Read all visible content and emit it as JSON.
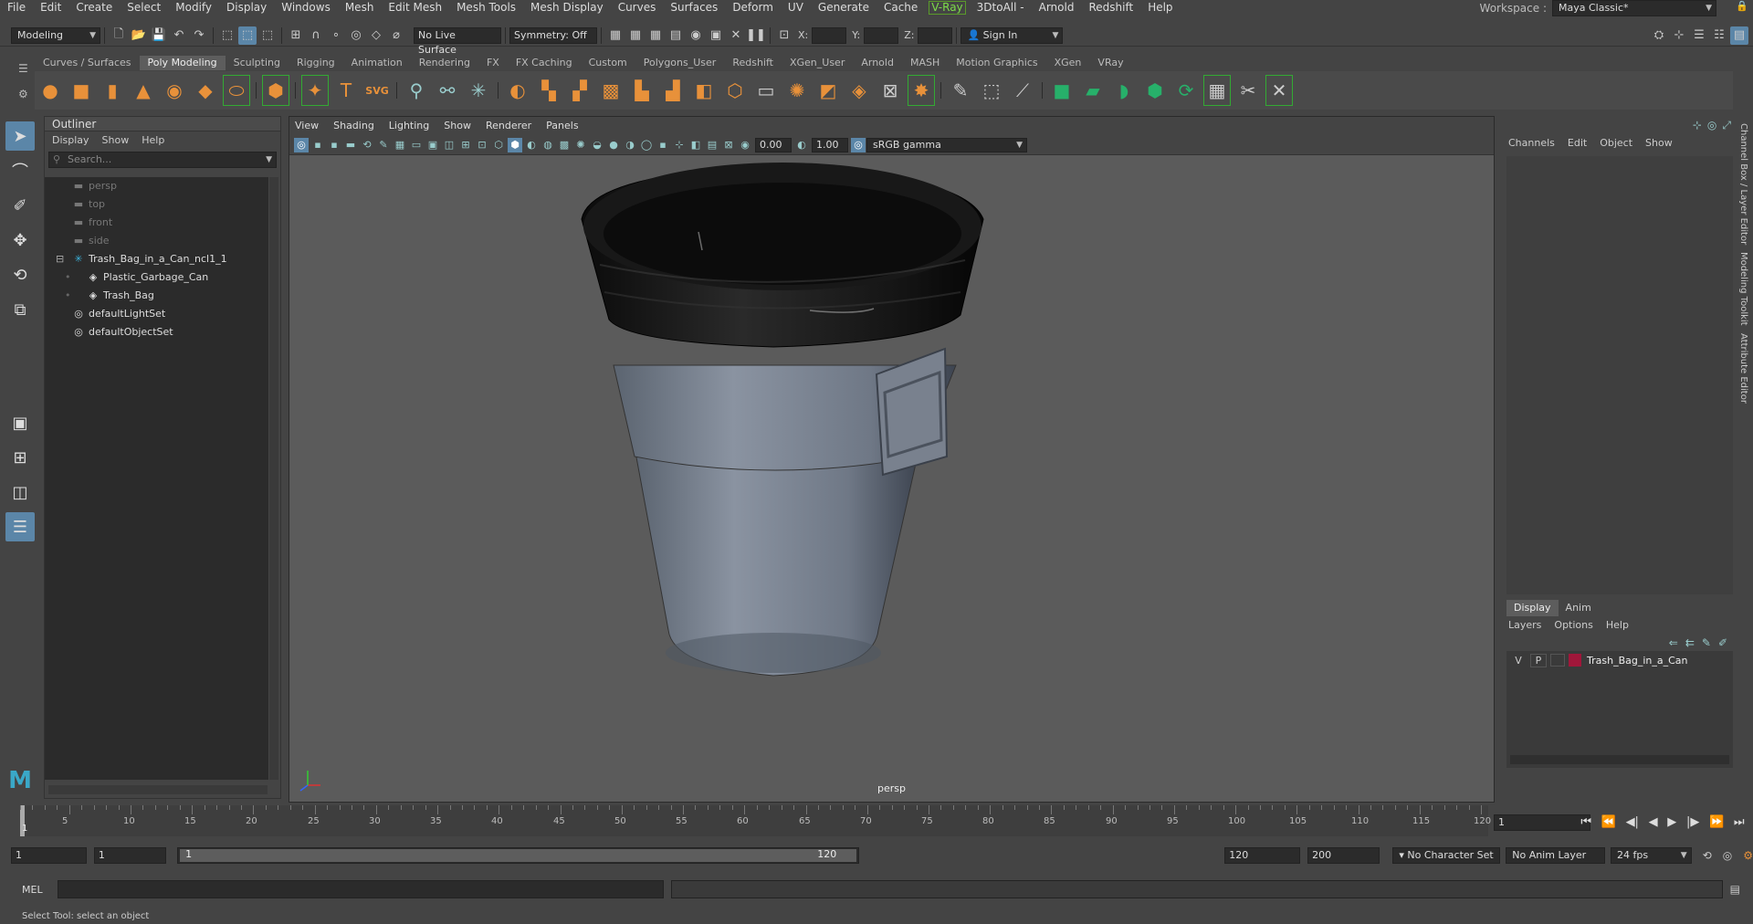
{
  "menu": {
    "items": [
      "File",
      "Edit",
      "Create",
      "Select",
      "Modify",
      "Display",
      "Windows",
      "Mesh",
      "Edit Mesh",
      "Mesh Tools",
      "Mesh Display",
      "Curves",
      "Surfaces",
      "Deform",
      "UV",
      "Generate",
      "Cache"
    ],
    "vray": "V-Ray",
    "items2": [
      "3DtoAll -",
      "Arnold",
      "Redshift",
      "Help"
    ]
  },
  "workspace": {
    "label": "Workspace :",
    "value": "Maya Classic*"
  },
  "status": {
    "mode": "Modeling",
    "live_surface": "No Live Surface",
    "symmetry": "Symmetry: Off",
    "x_label": "X:",
    "y_label": "Y:",
    "z_label": "Z:",
    "sign_in": "Sign In"
  },
  "shelf_tabs": [
    "Curves / Surfaces",
    "Poly Modeling",
    "Sculpting",
    "Rigging",
    "Animation",
    "Rendering",
    "FX",
    "FX Caching",
    "Custom",
    "Polygons_User",
    "Redshift",
    "XGen_User",
    "Arnold",
    "MASH",
    "Motion Graphics",
    "XGen",
    "VRay"
  ],
  "shelf_active": "Poly Modeling",
  "outliner": {
    "title": "Outliner",
    "menu": [
      "Display",
      "Show",
      "Help"
    ],
    "search_placeholder": "Search...",
    "items": [
      {
        "label": "persp",
        "icon": "camera-icon",
        "indent": 30,
        "dim": true
      },
      {
        "label": "top",
        "icon": "camera-icon",
        "indent": 30,
        "dim": true
      },
      {
        "label": "front",
        "icon": "camera-icon",
        "indent": 30,
        "dim": true
      },
      {
        "label": "side",
        "icon": "camera-icon",
        "indent": 30,
        "dim": true
      },
      {
        "label": "Trash_Bag_in_a_Can_ncl1_1",
        "icon": "nucleus-icon",
        "indent": 30,
        "dim": false,
        "expand": true
      },
      {
        "label": "Plastic_Garbage_Can",
        "icon": "mesh-icon",
        "indent": 46,
        "dim": false
      },
      {
        "label": "Trash_Bag",
        "icon": "mesh-icon",
        "indent": 46,
        "dim": false
      },
      {
        "label": "defaultLightSet",
        "icon": "set-icon",
        "indent": 30,
        "dim": false
      },
      {
        "label": "defaultObjectSet",
        "icon": "set-icon",
        "indent": 30,
        "dim": false
      }
    ]
  },
  "viewport": {
    "menu": [
      "View",
      "Shading",
      "Lighting",
      "Show",
      "Renderer",
      "Panels"
    ],
    "exposure": "0.00",
    "gamma": "1.00",
    "color_space": "sRGB gamma",
    "camera": "persp"
  },
  "channel_box": {
    "menu": [
      "Channels",
      "Edit",
      "Object",
      "Show"
    ]
  },
  "layer_editor": {
    "tabs": [
      "Display",
      "Anim"
    ],
    "menu": [
      "Layers",
      "Options",
      "Help"
    ],
    "layer": {
      "v": "V",
      "p": "P",
      "name": "Trash_Bag_in_a_Can",
      "color": "#a0173a"
    }
  },
  "side_tabs": [
    "Channel Box / Layer Editor",
    "Modeling Toolkit",
    "Attribute Editor"
  ],
  "timeline": {
    "ticks": [
      "5",
      "10",
      "15",
      "20",
      "25",
      "30",
      "35",
      "40",
      "45",
      "50",
      "55",
      "60",
      "65",
      "70",
      "75",
      "80",
      "85",
      "90",
      "95",
      "100",
      "105",
      "110",
      "115",
      "120"
    ],
    "current_frame": "1",
    "start_marker": "1"
  },
  "range": {
    "start": "1",
    "anim_start": "1",
    "slider_start": "1",
    "slider_end": "120",
    "end": "120",
    "anim_end": "200",
    "char_set": "No Character Set",
    "anim_layer": "No Anim Layer",
    "fps": "24 fps"
  },
  "command": {
    "label": "MEL"
  },
  "help_line": "Select Tool: select an object",
  "colors": {
    "accent": "#5b86a8",
    "shelf_orange": "#e8913a",
    "green": "#27b06a",
    "vray_green": "#7ddc4a"
  }
}
